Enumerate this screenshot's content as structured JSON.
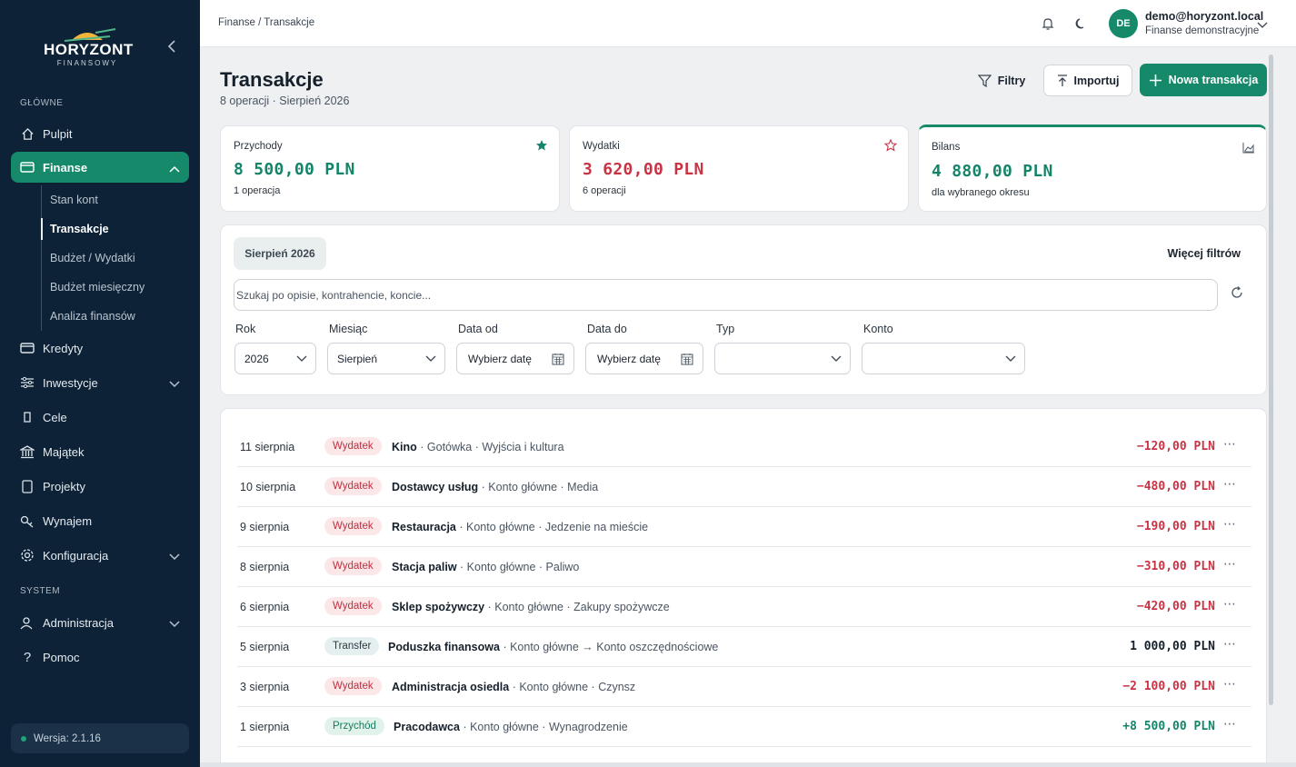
{
  "app": {
    "logo_text": "HORYZONT",
    "logo_sub": "FINANSOWY"
  },
  "sidebar": {
    "section_main": "GŁÓWNE",
    "section_system": "SYSTEM",
    "items": {
      "pulpit": "Pulpit",
      "finanse": "Finanse",
      "kredyty": "Kredyty",
      "inwestycje": "Inwestycje",
      "cele": "Cele",
      "majatek": "Majątek",
      "projekty": "Projekty",
      "wynajem": "Wynajem",
      "konfiguracja": "Konfiguracja",
      "administracja": "Administracja",
      "pomoc": "Pomoc"
    },
    "finanse_sub": [
      "Stan kont",
      "Transakcje",
      "Budżet / Wydatki",
      "Budżet miesięczny",
      "Analiza finansów"
    ],
    "version": "Wersja: 2.1.16"
  },
  "topbar": {
    "breadcrumb": "Finanse / Transakcje",
    "avatar_initials": "DE",
    "user_email": "demo@horyzont.local",
    "user_org": "Finanse demonstracyjne"
  },
  "page": {
    "title": "Transakcje",
    "subtitle": "8 operacji · Sierpień 2026",
    "btn_filters": "Filtry",
    "btn_import": "Importuj",
    "btn_new": "Nowa transakcja"
  },
  "summary": {
    "income": {
      "label": "Przychody",
      "value": "8 500,00 PLN",
      "note": "1 operacja"
    },
    "expenses": {
      "label": "Wydatki",
      "value": "3 620,00 PLN",
      "note": "6 operacji"
    },
    "balance": {
      "label": "Bilans",
      "value": "4 880,00 PLN",
      "note": "dla wybranego okresu"
    }
  },
  "filters": {
    "period_chip": "Sierpień 2026",
    "more_filters": "Więcej filtrów",
    "search_placeholder": "Szukaj po opisie, kontrahencie, koncie...",
    "labels": {
      "year": "Rok",
      "month": "Miesiąc",
      "date_from": "Data od",
      "date_to": "Data do",
      "type": "Typ",
      "account": "Konto"
    },
    "values": {
      "year": "2026",
      "month": "Sierpień",
      "date_from": "Wybierz datę",
      "date_to": "Wybierz datę",
      "type": "",
      "account": ""
    }
  },
  "transactions": [
    {
      "date": "11 sierpnia",
      "type": "Wydatek",
      "name": "Kino",
      "meta": "· Gotówka · Wyjścia i kultura",
      "amount": "−120,00 PLN",
      "kind": "expense"
    },
    {
      "date": "10 sierpnia",
      "type": "Wydatek",
      "name": "Dostawcy usług",
      "meta": "· Konto główne · Media",
      "amount": "−480,00 PLN",
      "kind": "expense"
    },
    {
      "date": "9 sierpnia",
      "type": "Wydatek",
      "name": "Restauracja",
      "meta": "· Konto główne · Jedzenie na mieście",
      "amount": "−190,00 PLN",
      "kind": "expense"
    },
    {
      "date": "8 sierpnia",
      "type": "Wydatek",
      "name": "Stacja paliw",
      "meta": "· Konto główne · Paliwo",
      "amount": "−310,00 PLN",
      "kind": "expense"
    },
    {
      "date": "6 sierpnia",
      "type": "Wydatek",
      "name": "Sklep spożywczy",
      "meta": "· Konto główne · Zakupy spożywcze",
      "amount": "−420,00 PLN",
      "kind": "expense"
    },
    {
      "date": "5 sierpnia",
      "type": "Transfer",
      "name": "Poduszka finansowa",
      "meta": "· Konto główne → Konto oszczędnościowe",
      "amount": "1 000,00 PLN",
      "kind": "transfer"
    },
    {
      "date": "3 sierpnia",
      "type": "Wydatek",
      "name": "Administracja osiedla",
      "meta": "· Konto główne · Czynsz",
      "amount": "−2 100,00 PLN",
      "kind": "expense"
    },
    {
      "date": "1 sierpnia",
      "type": "Przychód",
      "name": "Pracodawca",
      "meta": "· Konto główne · Wynagrodzenie",
      "amount": "+8 500,00 PLN",
      "kind": "income"
    }
  ],
  "colors": {
    "accent": "#15896a",
    "sidebar": "#0d2236",
    "expense": "#c93344",
    "income": "#15856a"
  },
  "icons": {
    "more": "⋯"
  }
}
